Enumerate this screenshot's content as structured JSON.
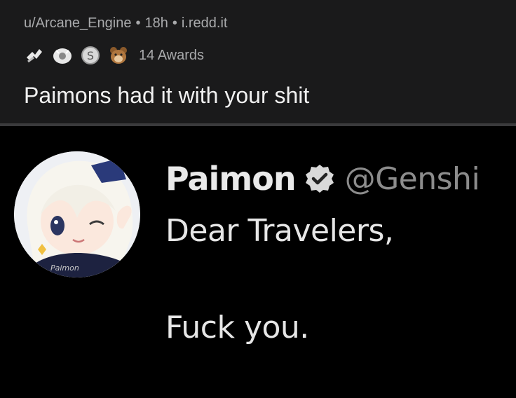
{
  "post": {
    "username": "u/Arcane_Engine",
    "age": "18h",
    "domain": "i.redd.it",
    "awards_label": "14 Awards",
    "title": "Paimons had it with your shit"
  },
  "awards_icons": [
    "wholesome-seal-icon",
    "rocket-like-icon",
    "silver-coin-icon",
    "dog-face-icon"
  ],
  "tweet": {
    "display_name": "Paimon",
    "handle": "@Genshi",
    "line1": "Dear Travelers,",
    "line2": "Fuck you.",
    "avatar_watermark": "Paimon"
  },
  "colors": {
    "header_bg": "#1a1a1b",
    "tweet_bg": "#000000",
    "meta_text": "#a9aaac",
    "title_text": "#f0f0f0"
  }
}
